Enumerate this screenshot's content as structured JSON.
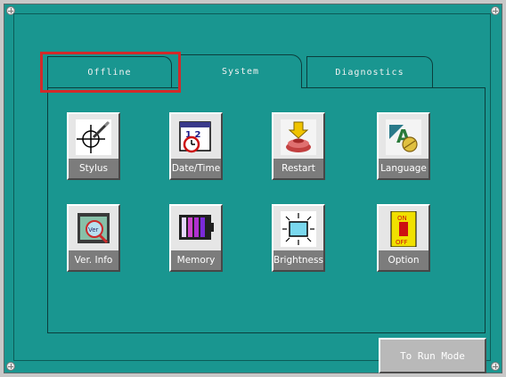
{
  "tabs": [
    {
      "label": "Offline"
    },
    {
      "label": "System"
    },
    {
      "label": "Diagnostics"
    }
  ],
  "tiles": [
    {
      "label": "Stylus",
      "icon": "stylus-crosshair-icon"
    },
    {
      "label": "Date/Time",
      "icon": "calendar-clock-icon"
    },
    {
      "label": "Restart",
      "icon": "restart-icon"
    },
    {
      "label": "Language",
      "icon": "language-icon"
    },
    {
      "label": "Ver. Info",
      "icon": "version-info-icon"
    },
    {
      "label": "Memory",
      "icon": "memory-icon"
    },
    {
      "label": "Brightness",
      "icon": "brightness-icon"
    },
    {
      "label": "Option",
      "icon": "on-off-switch-icon"
    }
  ],
  "calendar": {
    "digits": "1 2"
  },
  "option_switch": {
    "on": "ON",
    "off": "OFF"
  },
  "run_button": {
    "label": "To Run Mode"
  },
  "colors": {
    "background": "#199690",
    "highlight": "#d22a2a",
    "tile_label": "#7c7c7c"
  }
}
